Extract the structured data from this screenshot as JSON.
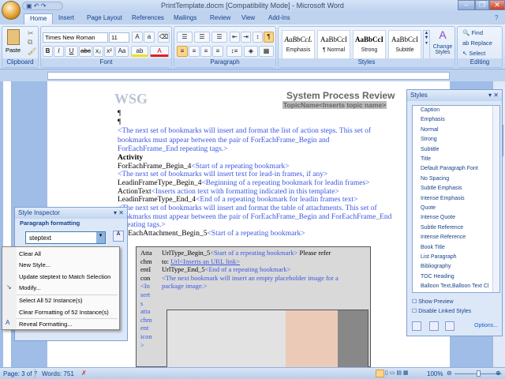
{
  "window": {
    "title": "PrintTemplate.docm [Compatibility Mode] - Microsoft Word"
  },
  "tabs": [
    "Home",
    "Insert",
    "Page Layout",
    "References",
    "Mailings",
    "Review",
    "View",
    "Add-Ins"
  ],
  "ribbon": {
    "clipboard": {
      "label": "Clipboard",
      "paste": "Paste"
    },
    "font": {
      "label": "Font",
      "name": "Times New Roman",
      "size": "11"
    },
    "paragraph": {
      "label": "Paragraph"
    },
    "styles": {
      "label": "Styles",
      "gallery": [
        {
          "sample": "AaBbCcL",
          "name": "Emphasis"
        },
        {
          "sample": "AaBbCcI",
          "name": "¶ Normal"
        },
        {
          "sample": "AaBbCcI",
          "name": "Strong"
        },
        {
          "sample": "AaBbCcI",
          "name": "Subtitle"
        }
      ],
      "change": "Change Styles"
    },
    "editing": {
      "label": "Editing",
      "find": "Find",
      "replace": "Replace",
      "select": "Select"
    }
  },
  "document": {
    "logo": "WSG",
    "header_title": "System Process Review",
    "header_topic": "TopicName<Inserts topic name>",
    "lines": [
      {
        "text": "<The next set of bookmarks will insert and format the list of action steps. This set of"
      },
      {
        "text": "bookmarks must appear between the pair of ForEachFrame_Begin and"
      },
      {
        "text": "ForEachFrame_End repeating tags.>"
      },
      {
        "text": "Activity"
      },
      {
        "a": "ForEachFrame_Begin_4",
        "b": "<Start of a repeating bookmark>"
      },
      {
        "text": "<The next set of bookmarks will insert text for lead-in frames, if any>"
      },
      {
        "a": "LeadinFrameType_Begin_4",
        "b": "<Beginning of a repeating bookmark for leadin frames>"
      },
      {
        "a": "ActionText",
        "b": "<Inserts action text with formatting indicated in this template>"
      },
      {
        "a": "LeadinFrameType_End_4",
        "b": "<End of a repeating bookmark for leadin frames text>"
      },
      {
        "text": "<The next set of bookmarks will insert and format the table of attachments. This set of"
      },
      {
        "text": "bookmarks must appear between the pair of ForEachFrame_Begin and ForEachFrame_End"
      },
      {
        "text": "repeating tags.>"
      },
      {
        "a": "ForEachAttachment_Begin_5",
        "b": "<Start of a repeating bookmark>"
      }
    ],
    "table": {
      "left_col": [
        "Atta",
        "chm",
        "entI",
        "con",
        "<In",
        "sert",
        "s",
        "atta",
        "chm",
        "ent",
        "icon",
        ">"
      ],
      "r1a": "UrlType_Begin_5",
      "r1b": "<Start of a repeating bookmark>",
      "r1c": " Please refer",
      "r2a": "to: ",
      "r2b": "Url<Inserts an URL link>",
      "r3a": "UrlType_End_5",
      "r3b": "<End of a repeating bookmark>",
      "r4": "<The next bookmark will insert an empty placeholder image for a",
      "r5": "package image.>"
    }
  },
  "style_inspector": {
    "title": "Style Inspector",
    "section": "Paragraph formatting",
    "value": "steptext"
  },
  "context_menu": [
    "Clear All",
    "New Style...",
    "Update steptext to Match Selection",
    "Modify...",
    "Select All 52 Instance(s)",
    "Clear Formatting of 52 Instance(s)",
    "Reveal Formatting..."
  ],
  "styles_pane": {
    "title": "Styles",
    "items": [
      {
        "name": "Caption",
        "icon": "¶"
      },
      {
        "name": "Emphasis",
        "icon": "a"
      },
      {
        "name": "Normal",
        "icon": "¶"
      },
      {
        "name": "Strong",
        "icon": "a"
      },
      {
        "name": "Subtitle",
        "icon": "¶a"
      },
      {
        "name": "Title",
        "icon": "¶a"
      },
      {
        "name": "Default Paragraph Font",
        "icon": "a"
      },
      {
        "name": "No Spacing",
        "icon": "¶"
      },
      {
        "name": "Subtle Emphasis",
        "icon": "a"
      },
      {
        "name": "Intense Emphasis",
        "icon": "a"
      },
      {
        "name": "Quote",
        "icon": "¶a"
      },
      {
        "name": "Intense Quote",
        "icon": "¶a"
      },
      {
        "name": "Subtle Reference",
        "icon": "a"
      },
      {
        "name": "Intense Reference",
        "icon": "a"
      },
      {
        "name": "Book Title",
        "icon": "a"
      },
      {
        "name": "List Paragraph",
        "icon": "¶"
      },
      {
        "name": "Bibliography",
        "icon": "¶"
      },
      {
        "name": "TOC Heading",
        "icon": "¶"
      },
      {
        "name": "Balloon Text,Balloon Text Cl",
        "icon": "¶"
      }
    ],
    "show_preview": "Show Preview",
    "disable_linked": "Disable Linked Styles",
    "options": "Options..."
  },
  "status": {
    "page": "Page: 3 of 7",
    "words": "Words: 751",
    "zoom": "100%"
  }
}
